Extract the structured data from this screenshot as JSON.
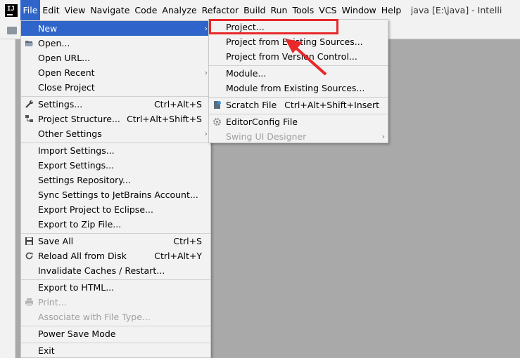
{
  "menubar": {
    "items": [
      "File",
      "Edit",
      "View",
      "Navigate",
      "Code",
      "Analyze",
      "Refactor",
      "Build",
      "Run",
      "Tools",
      "VCS",
      "Window",
      "Help"
    ],
    "title": "java [E:\\java] - Intelli"
  },
  "file_menu": {
    "new": "New",
    "open": "Open...",
    "open_url": "Open URL...",
    "open_recent": "Open Recent",
    "close_project": "Close Project",
    "settings": "Settings...",
    "settings_shortcut": "Ctrl+Alt+S",
    "project_structure": "Project Structure...",
    "project_structure_shortcut": "Ctrl+Alt+Shift+S",
    "other_settings": "Other Settings",
    "import_settings": "Import Settings...",
    "export_settings": "Export Settings...",
    "settings_repository": "Settings Repository...",
    "sync_settings": "Sync Settings to JetBrains Account...",
    "export_eclipse": "Export Project to Eclipse...",
    "export_zip": "Export to Zip File...",
    "save_all": "Save All",
    "save_all_shortcut": "Ctrl+S",
    "reload": "Reload All from Disk",
    "reload_shortcut": "Ctrl+Alt+Y",
    "invalidate": "Invalidate Caches / Restart...",
    "export_html": "Export to HTML...",
    "print": "Print...",
    "associate": "Associate with File Type...",
    "power_save": "Power Save Mode",
    "exit": "Exit"
  },
  "new_submenu": {
    "project": "Project...",
    "project_existing": "Project from Existing Sources...",
    "project_vcs": "Project from Version Control...",
    "module": "Module...",
    "module_existing": "Module from Existing Sources...",
    "scratch_file": "Scratch File",
    "scratch_shortcut": "Ctrl+Alt+Shift+Insert",
    "editorconfig": "EditorConfig File",
    "swing_designer": "Swing UI Designer"
  },
  "colors": {
    "highlight": "#2f65ca",
    "annotation": "#e8282b",
    "menu_bg": "#f2f2f2",
    "workspace": "#a9a9a9"
  },
  "icons": {
    "app": "intellij-logo-icon",
    "open": "folder-open-icon",
    "settings": "wrench-icon",
    "project_structure": "structure-icon",
    "save_all": "floppy-disk-icon",
    "reload": "refresh-icon",
    "print": "printer-icon",
    "scratch": "scratch-file-icon",
    "editorconfig": "gear-icon"
  }
}
